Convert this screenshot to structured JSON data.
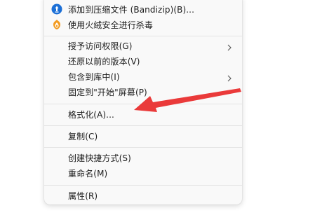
{
  "menu": {
    "items": [
      {
        "label": "添加到压缩文件 (Bandizip)(B)...",
        "icon": "bandizip-icon"
      },
      {
        "label": "使用火绒安全进行杀毒",
        "icon": "huorong-shield-icon"
      },
      {
        "label": "授予访问权限(G)",
        "submenu": true
      },
      {
        "label": "还原以前的版本(V)"
      },
      {
        "label": "包含到库中(I)",
        "submenu": true
      },
      {
        "label": "固定到\"开始\"屏幕(P)"
      },
      {
        "label": "格式化(A)..."
      },
      {
        "label": "复制(C)"
      },
      {
        "label": "创建快捷方式(S)"
      },
      {
        "label": "重命名(M)"
      },
      {
        "label": "属性(R)"
      }
    ]
  },
  "colors": {
    "menu_bg": "#f9f9f9",
    "separator": "#e3e3e3",
    "text": "#1b1b1b",
    "annotation_arrow": "#ea3a3a",
    "bandizip_blue": "#1b6fd6",
    "huorong_orange": "#f29a1f"
  }
}
